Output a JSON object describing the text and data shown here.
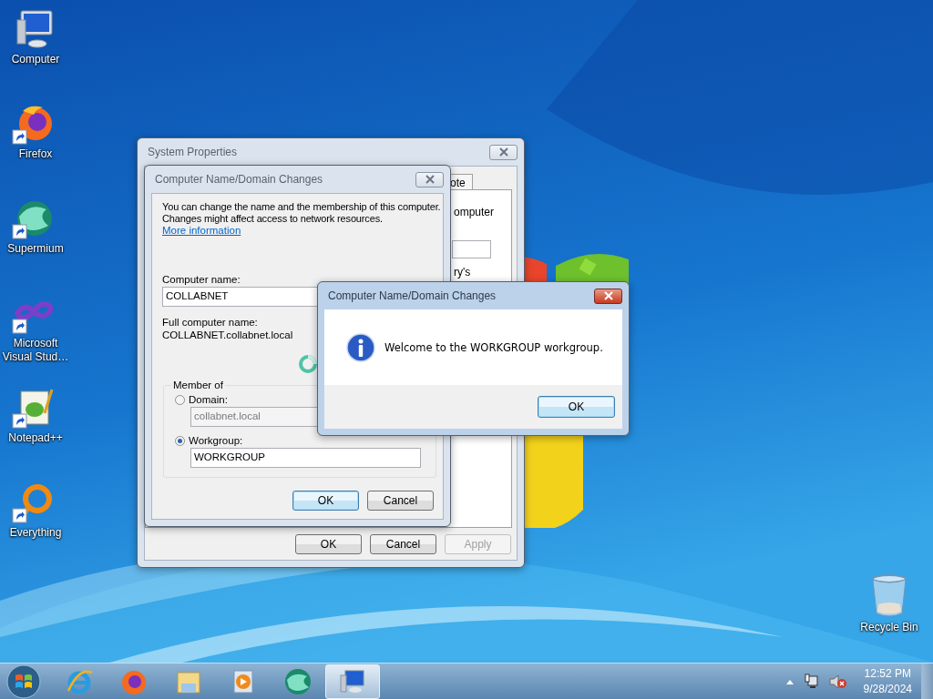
{
  "desktop_icons": [
    {
      "label": "Computer",
      "shortcut": false
    },
    {
      "label": "Firefox",
      "shortcut": true
    },
    {
      "label": "Supermium",
      "shortcut": true
    },
    {
      "label": "Microsoft Visual Stud…",
      "shortcut": true
    },
    {
      "label": "Notepad++",
      "shortcut": true
    },
    {
      "label": "Everything",
      "shortcut": true
    }
  ],
  "recycle_bin": {
    "label": "Recycle Bin"
  },
  "system_properties": {
    "title": "System Properties",
    "active": false,
    "tab": "ote",
    "fragments": [
      "omputer",
      "ry's"
    ],
    "buttons": [
      {
        "label": "OK",
        "default": false,
        "disabled": false
      },
      {
        "label": "Cancel",
        "default": false,
        "disabled": false
      },
      {
        "label": "Apply",
        "default": false,
        "disabled": true
      }
    ]
  },
  "name_dialog": {
    "title": "Computer Name/Domain Changes",
    "active": false,
    "intro": "You can change the name and the membership of this computer. Changes might affect access to network resources.",
    "link": "More information",
    "computer_name_label": "Computer name:",
    "computer_name": "COLLABNET",
    "full_name_label": "Full computer name:",
    "full_name": "COLLABNET.collabnet.local",
    "member_of": "Member of",
    "options": [
      {
        "label": "Domain:",
        "selected": false,
        "value": "collabnet.local"
      },
      {
        "label": "Workgroup:",
        "selected": true,
        "value": "WORKGROUP"
      }
    ],
    "buttons": [
      {
        "label": "OK",
        "default": true,
        "disabled": false
      },
      {
        "label": "Cancel",
        "default": false,
        "disabled": false
      }
    ]
  },
  "message_box": {
    "title": "Computer Name/Domain Changes",
    "active": true,
    "message": "Welcome to the WORKGROUP workgroup.",
    "buttons": [
      {
        "label": "OK",
        "default": true,
        "disabled": false
      }
    ]
  },
  "taskbar": {
    "items": [
      {
        "selected": false
      },
      {
        "selected": false
      },
      {
        "selected": false
      },
      {
        "selected": false
      },
      {
        "selected": false
      },
      {
        "selected": true
      }
    ],
    "clock": {
      "time": "12:52 PM",
      "date": "9/28/2024"
    }
  }
}
